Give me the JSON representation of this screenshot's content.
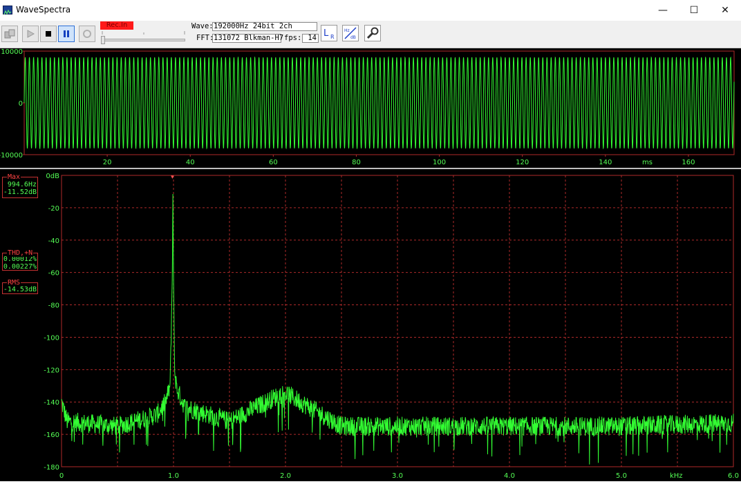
{
  "window": {
    "title": "WaveSpectra",
    "minimize": "—",
    "maximize": "☐",
    "close": "✕"
  },
  "toolbar": {
    "rec_label": "Rec.In",
    "wave_label": "Wave:",
    "wave_value": "192000Hz 24bit 2ch",
    "fft_label": "FFT:",
    "fft_value": "131072 Blkman-H7",
    "fps_label": "fps:",
    "fps_value": "14",
    "icons": [
      "device-settings-icon",
      "play-icon",
      "stop-icon",
      "pause-icon",
      "record-icon",
      "lr-channel-icon",
      "hz-db-scale-icon",
      "wrench-icon"
    ]
  },
  "colors": {
    "trace": "#33ff33",
    "grid": "#b02a2a",
    "axis_label": "#55ff55",
    "readout_title": "#ff4444",
    "rec_bg": "#ff1a1a"
  },
  "waveform": {
    "y_ticks": [
      "10000",
      "0",
      "-10000"
    ],
    "x_ticks": [
      "20",
      "40",
      "60",
      "80",
      "100",
      "120",
      "140",
      "160"
    ],
    "x_unit": "ms"
  },
  "spectrum": {
    "y_ticks": [
      "0dB",
      "-20",
      "-40",
      "-60",
      "-80",
      "-100",
      "-120",
      "-140",
      "-160",
      "-180"
    ],
    "x_ticks": [
      "0",
      "1.0",
      "2.0",
      "3.0",
      "4.0",
      "5.0",
      "6.0"
    ],
    "x_unit": "kHz",
    "peak_marker": "▾"
  },
  "readouts": {
    "max_title": "Max",
    "max_freq": "994.6Hz",
    "max_db": "-11.52dB",
    "thd_title": "THD,+N",
    "thd_value": "0.00012%",
    "thdn_value": "0.00227%",
    "rms_title": "RMS",
    "rms_value": "-14.53dB"
  },
  "chart_data": [
    {
      "type": "line",
      "title": "",
      "xlabel": "ms",
      "ylabel": "",
      "xlim": [
        0,
        171
      ],
      "ylim": [
        -10000,
        10000
      ],
      "grid": false,
      "series": [
        {
          "signal": "sine",
          "frequency_hz": 994.6,
          "amplitude": 8800
        }
      ]
    },
    {
      "type": "line",
      "title": "",
      "xlabel": "kHz",
      "ylabel": "dB",
      "xlim": [
        0,
        6.0
      ],
      "ylim": [
        -180,
        0
      ],
      "grid": true,
      "noise_floor_db": -155,
      "series": [
        {
          "points": [
            {
              "x": 0.0,
              "y": -140
            },
            {
              "x": 0.05,
              "y": -152
            },
            {
              "x": 0.5,
              "y": -155
            },
            {
              "x": 0.85,
              "y": -148
            },
            {
              "x": 0.93,
              "y": -140
            },
            {
              "x": 0.97,
              "y": -130
            },
            {
              "x": 0.99,
              "y": -60
            },
            {
              "x": 0.9946,
              "y": -11.52
            },
            {
              "x": 1.0,
              "y": -60
            },
            {
              "x": 1.01,
              "y": -121
            },
            {
              "x": 1.03,
              "y": -132
            },
            {
              "x": 1.1,
              "y": -143
            },
            {
              "x": 1.5,
              "y": -152
            },
            {
              "x": 1.99,
              "y": -134
            },
            {
              "x": 2.5,
              "y": -155
            },
            {
              "x": 3.0,
              "y": -155
            },
            {
              "x": 4.0,
              "y": -155
            },
            {
              "x": 5.0,
              "y": -155
            },
            {
              "x": 6.0,
              "y": -153
            }
          ]
        }
      ]
    }
  ]
}
